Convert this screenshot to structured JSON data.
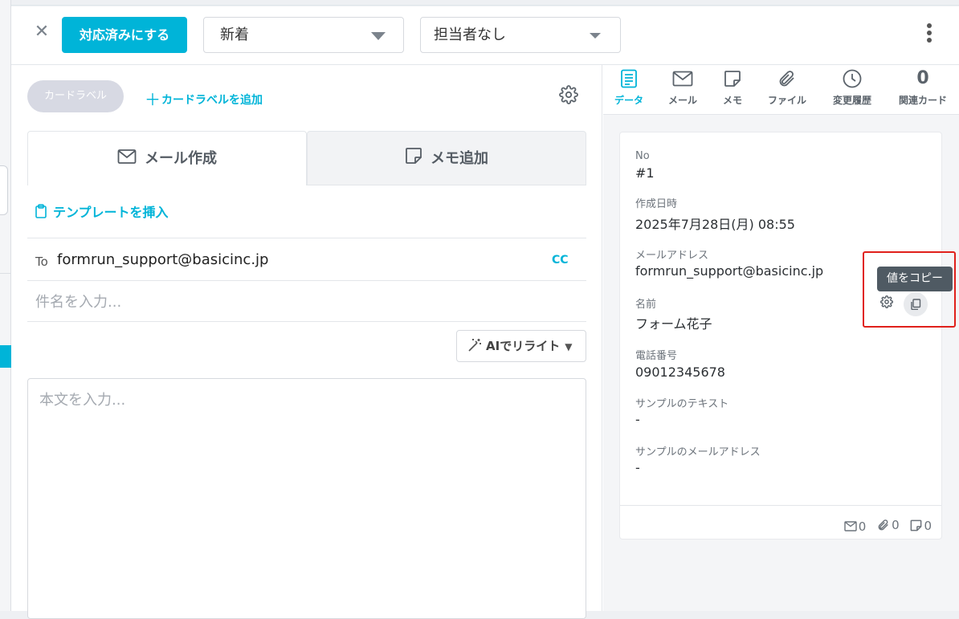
{
  "header": {
    "close_glyph": "✕",
    "resolve_button": "対応済みにする",
    "status_select": "新着",
    "assignee_select": "担当者なし"
  },
  "left": {
    "card_label_pill": "カードラベル",
    "add_card_label": "カードラベルを追加",
    "tabs": {
      "mail": "メール作成",
      "memo": "メモ追加"
    },
    "insert_template": "テンプレートを挿入",
    "to_label": "To",
    "to_value": "formrun_support@basicinc.jp",
    "cc_label": "CC",
    "subject_placeholder": "件名を入力...",
    "ai_button": "AIでリライト",
    "body_placeholder": "本文を入力..."
  },
  "right": {
    "tabs": [
      {
        "label": "データ",
        "icon": "document-icon"
      },
      {
        "label": "メール",
        "icon": "mail-icon"
      },
      {
        "label": "メモ",
        "icon": "sticky-note-icon"
      },
      {
        "label": "ファイル",
        "icon": "paperclip-icon"
      },
      {
        "label": "変更履歴",
        "icon": "clock-icon"
      },
      {
        "label": "関連カード",
        "count": "0"
      }
    ],
    "fields": [
      {
        "label": "No",
        "value": "#1"
      },
      {
        "label": "作成日時",
        "value": "2025年7月28日(月) 08:55"
      },
      {
        "label": "メールアドレス",
        "value": "formrun_support@basicinc.jp"
      },
      {
        "label": "名前",
        "value": "フォーム花子"
      },
      {
        "label": "電話番号",
        "value": "09012345678"
      },
      {
        "label": "サンプルのテキスト",
        "value": "-"
      },
      {
        "label": "サンプルのメールアドレス",
        "value": "-"
      }
    ],
    "footer_counts": {
      "mail": "0",
      "files": "0",
      "memos": "0"
    },
    "tooltip": "値をコピー"
  },
  "colors": {
    "accent": "#00b4d8",
    "highlight": "#e0201b"
  }
}
